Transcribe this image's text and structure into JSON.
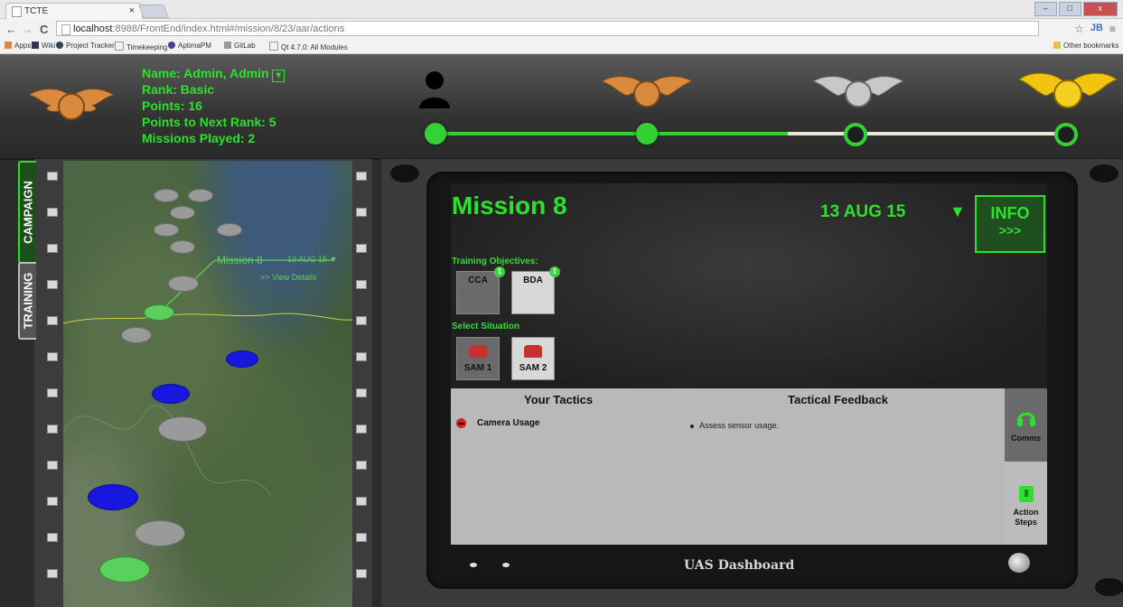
{
  "browser": {
    "tab_title": "TCTE",
    "tab_close": "×",
    "url_host": "localhost",
    "url_rest": ":8988/FrontEnd/index.html#/mission/8/23/aar/actions",
    "back": "←",
    "forward": "→",
    "reload": "C",
    "profile": "JB",
    "menu": "≡",
    "star": "☆",
    "bookmarks": [
      "Apps",
      "Wiki",
      "Project Tracker",
      "Timekeeping",
      "AptimaPM",
      "GitLab",
      "Qt 4.7.0: All Modules"
    ],
    "other_bookmarks": "Other bookmarks",
    "win_min": "–",
    "win_max": "□",
    "win_close": "x"
  },
  "profile": {
    "name": "Name: Admin, Admin",
    "rank": "Rank: Basic",
    "points": "Points: 16",
    "points_next": "Points to Next Rank: 5",
    "missions": "Missions Played: 2",
    "dropdown": "▾"
  },
  "progress": {
    "nodes": [
      "completed",
      "completed",
      "current",
      "locked"
    ],
    "colors": {
      "active": "#32d232",
      "inactive": "#e8e4d8",
      "bronze": "#d98a3c",
      "silver": "#c8c8c8",
      "gold": "#f1c40f"
    }
  },
  "sidebar": {
    "tabs": [
      {
        "label": "CAMPAIGN",
        "active": true
      },
      {
        "label": "TRAINING",
        "active": false
      }
    ]
  },
  "map": {
    "callout_title": "Mission 8",
    "callout_date": "13 AUG 15 ▼",
    "callout_link": ">> View Details"
  },
  "dashboard": {
    "mission_title": "Mission 8",
    "date": "13 AUG 15",
    "date_toggle": "▼",
    "info_label": "INFO",
    "info_arrows": ">>>",
    "objectives_label": "Training Objectives:",
    "objectives": [
      {
        "label": "CCA",
        "badge": "1"
      },
      {
        "label": "BDA",
        "badge": "1"
      }
    ],
    "situation_label": "Select Situation",
    "situations": [
      {
        "label": "SAM 1"
      },
      {
        "label": "SAM 2"
      }
    ],
    "tactics_header": "Your Tactics",
    "feedback_header": "Tactical Feedback",
    "tactics": [
      "Camera Usage"
    ],
    "feedback": [
      "Assess sensor usage."
    ],
    "comms_label": "Comms",
    "action_steps_label": "Action Steps",
    "footer_label": "UAS Dashboard"
  }
}
